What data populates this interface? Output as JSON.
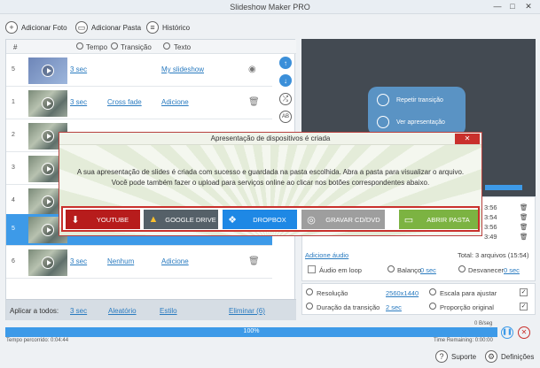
{
  "app": {
    "title": "Slideshow Maker PRO"
  },
  "window": {
    "minimize": "—",
    "maximize": "□",
    "close": "✕"
  },
  "toolbar": {
    "add_photo": "Adicionar Foto",
    "add_folder": "Adicionar Pasta",
    "history": "Histórico"
  },
  "list": {
    "headers": {
      "num": "#",
      "time": "Tempo",
      "transition": "Transição",
      "text": "Texto"
    },
    "rows": [
      {
        "num": "5",
        "time": "3 sec",
        "transition": "",
        "text": "My slideshow"
      },
      {
        "num": "1",
        "time": "3 sec",
        "transition": "Cross fade",
        "text": "Adicione"
      },
      {
        "num": "2",
        "time": "",
        "transition": "",
        "text": ""
      },
      {
        "num": "3",
        "time": "",
        "transition": "",
        "text": ""
      },
      {
        "num": "4",
        "time": "",
        "transition": "",
        "text": ""
      },
      {
        "num": "5",
        "time": "",
        "transition": "",
        "text": ""
      },
      {
        "num": "6",
        "time": "3 sec",
        "transition": "Nenhum",
        "text": "Adicione"
      }
    ]
  },
  "applybar": {
    "label": "Aplicar a todos:",
    "time": "3 sec",
    "random": "Aleatório",
    "style": "Estilo",
    "remove": "Eliminar (6)"
  },
  "preview": {
    "repeat": "Repetir transição",
    "view": "Ver apresentação"
  },
  "audio": {
    "times": [
      "3:56",
      "3:54",
      "3:56",
      "3:49"
    ],
    "add_audio": "Adicione áudio",
    "total": "Total: 3 arquivos (15:54)",
    "loop_label": "Áudio em loop",
    "balance_label": "Balanço",
    "balance_value": "0 sec",
    "fade_label": "Desvanecer",
    "fade_value": "0 sec"
  },
  "settings": {
    "resolution_label": "Resolução",
    "resolution_value": "2560x1440",
    "transition_label": "Duração da transição",
    "transition_value": "2 sec",
    "fit_label": "Escala para ajustar",
    "ratio_label": "Proporção original"
  },
  "progress": {
    "percent": "100%",
    "value": 1.0,
    "speed": "0 B/seg",
    "elapsed": "Tempo percorrido: 0:04:44",
    "remaining": "Time Remaining: 0:00:00"
  },
  "dialog": {
    "title": "Apresentação de dispositivos é criada",
    "close": "✕",
    "message1": "A sua apresentação de slides é criada com sucesso e guardada na pasta escolhida. Abra a pasta para visualizar o arquivo.",
    "message2": "Você pode também fazer o upload para serviços online ao clicar nos botões correspondentes abaixo.",
    "buttons": {
      "youtube": "YOUTUBE",
      "drive": "GOOGLE DRIVE",
      "dropbox": "DROPBOX",
      "cd": "GRAVAR CD/DVD",
      "folder": "ABRIR PASTA"
    }
  },
  "footer": {
    "support": "Suporte",
    "settings": "Definições"
  },
  "colors": {
    "accent": "#3d9ae8",
    "dialog_border": "#c9302c",
    "youtube": "#b71c1c",
    "drive": "#556068",
    "dropbox": "#1e88e5",
    "cd": "#9e9e9e",
    "folder": "#7cb342"
  }
}
